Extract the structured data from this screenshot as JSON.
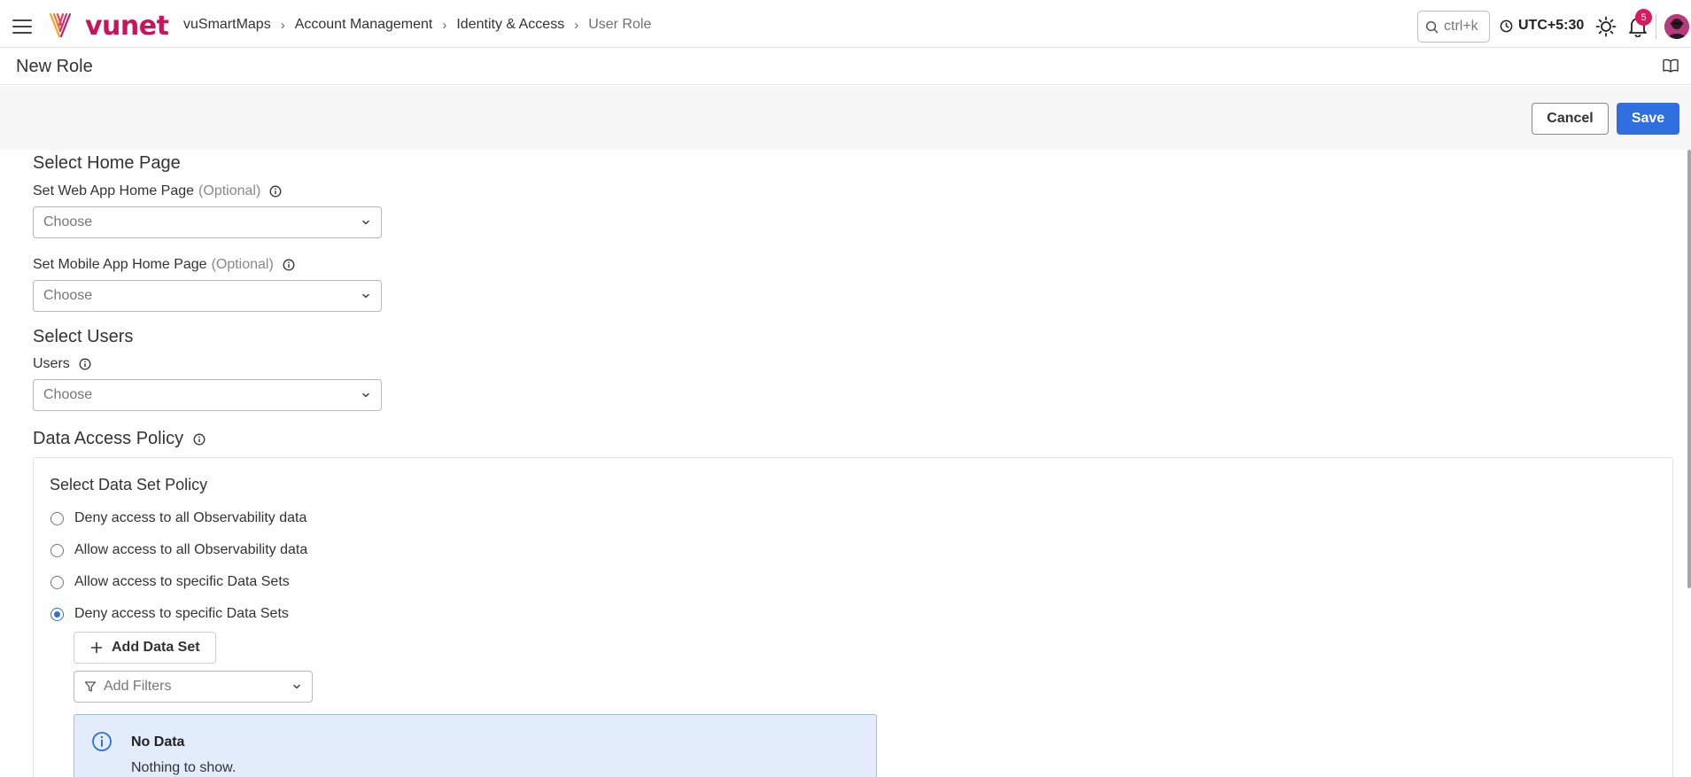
{
  "app": {
    "brand": "vunet",
    "notification_count": "5",
    "timezone": "UTC+5:30"
  },
  "breadcrumb": [
    "vuSmartMaps",
    "Account Management",
    "Identity & Access",
    "User Role"
  ],
  "search": {
    "placeholder": "ctrl+k"
  },
  "page": {
    "title": "New Role"
  },
  "actions": {
    "cancel": "Cancel",
    "save": "Save"
  },
  "home_page": {
    "heading": "Select Home Page",
    "web_label": "Set Web App Home Page",
    "web_optional": "(Optional)",
    "web_placeholder": "Choose",
    "mobile_label": "Set Mobile App Home Page",
    "mobile_optional": "(Optional)",
    "mobile_placeholder": "Choose"
  },
  "users": {
    "heading": "Select Users",
    "label": "Users",
    "placeholder": "Choose"
  },
  "data_access": {
    "heading": "Data Access Policy",
    "box_title": "Select Data Set Policy",
    "options": [
      {
        "label": "Deny access to all Observability data",
        "selected": false
      },
      {
        "label": "Allow access to all Observability data",
        "selected": false
      },
      {
        "label": "Allow access to specific Data Sets",
        "selected": false
      },
      {
        "label": "Deny access to specific Data Sets",
        "selected": true
      }
    ],
    "add_data_set": "Add Data Set",
    "filters_placeholder": "Add Filters",
    "empty_title": "No Data",
    "empty_message": "Nothing to show."
  },
  "colors": {
    "brand": "#c8145a",
    "primary": "#2f6fdf",
    "info_bg": "#e3ecfb",
    "badge": "#d81b60"
  },
  "icons": [
    "menu-icon",
    "search-icon",
    "clock-icon",
    "sun-icon",
    "bell-icon",
    "book-icon",
    "info-icon",
    "chevron-down-icon",
    "plus-icon",
    "filter-icon"
  ]
}
